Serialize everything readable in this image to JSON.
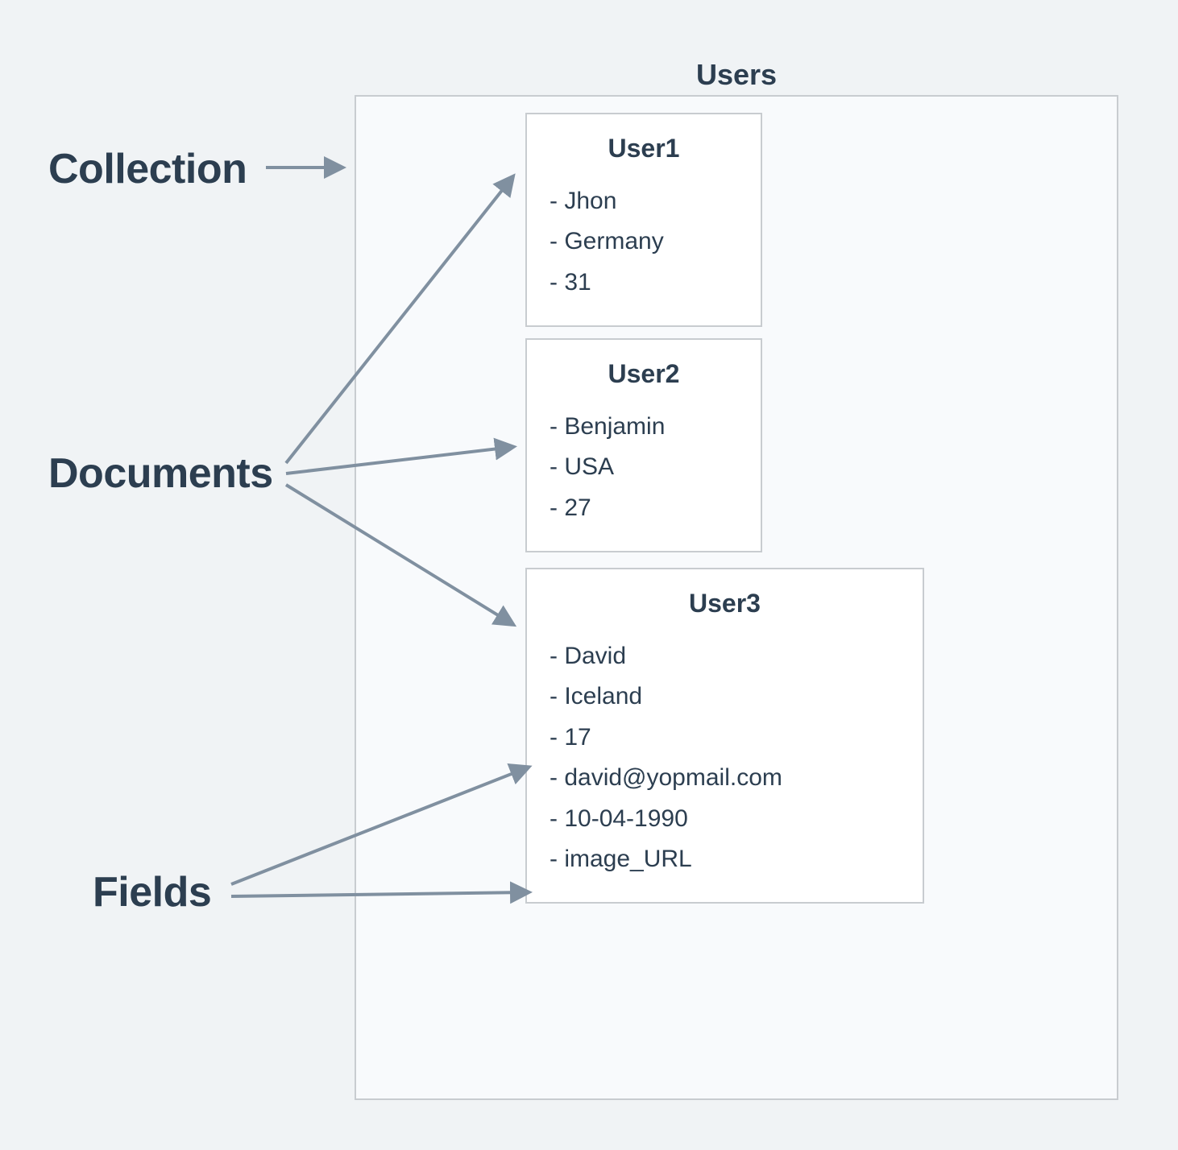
{
  "labels": {
    "collection": "Collection",
    "documents": "Documents",
    "fields": "Fields"
  },
  "collection": {
    "title": "Users",
    "documents": [
      {
        "title": "User1",
        "fields": [
          "Jhon",
          "Germany",
          "31"
        ]
      },
      {
        "title": "User2",
        "fields": [
          "Benjamin",
          "USA",
          "27"
        ]
      },
      {
        "title": "User3",
        "fields": [
          "David",
          "Iceland",
          "17",
          "david@yopmail.com",
          "10-04-1990",
          "image_URL"
        ]
      }
    ]
  },
  "colors": {
    "bg": "#f0f3f5",
    "text": "#2c3e50",
    "border": "#c8ccd0",
    "arrow": "#8090a0"
  }
}
